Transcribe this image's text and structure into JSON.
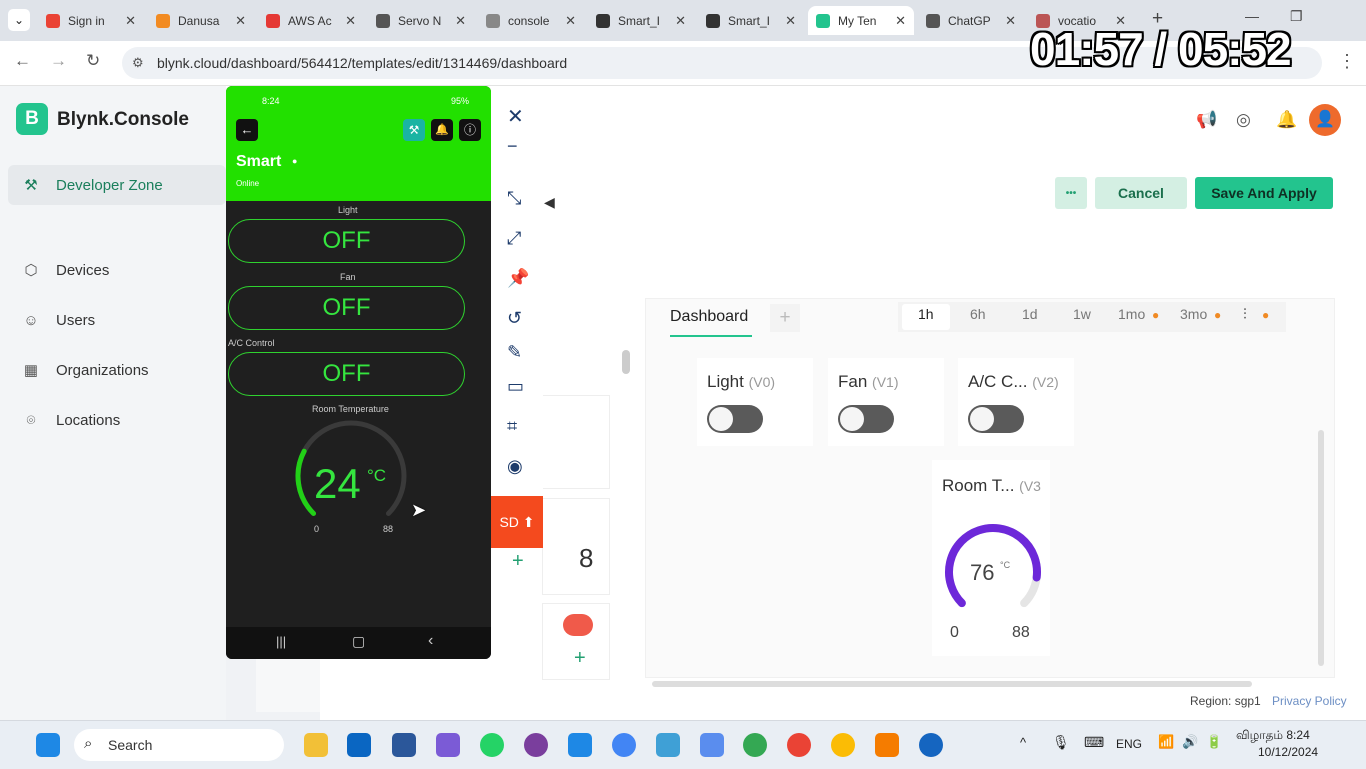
{
  "browser": {
    "tabs": [
      {
        "title": "Sign in",
        "icon": "gmail-icon",
        "color": "#ea4335"
      },
      {
        "title": "Danusa",
        "icon": "avatar-icon",
        "color": "#f28b22"
      },
      {
        "title": "AWS Ac",
        "icon": "aws-icon",
        "color": "#e53935"
      },
      {
        "title": "Servo N",
        "icon": "chatgpt-icon",
        "color": "#555555"
      },
      {
        "title": "console",
        "icon": "drop-icon",
        "color": "#888888"
      },
      {
        "title": "Smart_I",
        "icon": "wordpress-icon",
        "color": "#333333"
      },
      {
        "title": "Smart_I",
        "icon": "wordpress-icon",
        "color": "#333333"
      },
      {
        "title": "My Ten",
        "icon": "blynk-icon",
        "color": "#23c48e"
      },
      {
        "title": "ChatGP",
        "icon": "chatgpt-icon",
        "color": "#555555"
      },
      {
        "title": "vocatio",
        "icon": "image-icon",
        "color": "#b55"
      }
    ],
    "url": "blynk.cloud/dashboard/564412/templates/edit/1314469/dashboard",
    "timer": "01:57 / 05:52"
  },
  "sidebar": {
    "logo": "B",
    "app_name": "Blynk.Console",
    "items": [
      {
        "label": "Developer Zone",
        "icon": "wrench-icon"
      },
      {
        "label": "Devices",
        "icon": "cube-icon"
      },
      {
        "label": "Users",
        "icon": "users-icon"
      },
      {
        "label": "Organizations",
        "icon": "building-icon"
      },
      {
        "label": "Locations",
        "icon": "pin-icon"
      }
    ]
  },
  "toolbar": {
    "more_label": "•••",
    "cancel_label": "Cancel",
    "save_label": "Save And Apply"
  },
  "dashboard": {
    "tab_label": "Dashboard",
    "add_tab": "+",
    "time_ranges": [
      "1h",
      "6h",
      "1d",
      "1w",
      "1mo",
      "3mo"
    ],
    "widgets": [
      {
        "title": "Light",
        "pin": "(V0)"
      },
      {
        "title": "Fan",
        "pin": "(V1)"
      },
      {
        "title": "A/C C...",
        "pin": "(V2)"
      }
    ],
    "gauge": {
      "title": "Room T...",
      "pin": "(V3",
      "value": "76",
      "unit": "°C",
      "min": "0",
      "max": "88",
      "fraction": 0.86
    },
    "side_number": "8",
    "side_number2": "0"
  },
  "phone": {
    "status_time": "8:24",
    "status_right": "95%",
    "title": "Smart",
    "status": "Online",
    "controls": [
      {
        "label": "Light",
        "value": "OFF"
      },
      {
        "label": "Fan",
        "value": "OFF"
      },
      {
        "label": "A/C Control",
        "value": "OFF"
      }
    ],
    "gauge": {
      "label": "Room Temperature",
      "value": "24",
      "unit": "°C",
      "min": "0",
      "max": "88",
      "fraction": 0.27
    }
  },
  "floating_tool": {
    "sd_label": "SD"
  },
  "footer": {
    "region": "Region: sgp1",
    "privacy": "Privacy Policy"
  },
  "taskbar": {
    "search": "Search",
    "lang": "ENG",
    "date_line1": "விழாதம் 8:24",
    "date_line2": "10/12/2024"
  }
}
